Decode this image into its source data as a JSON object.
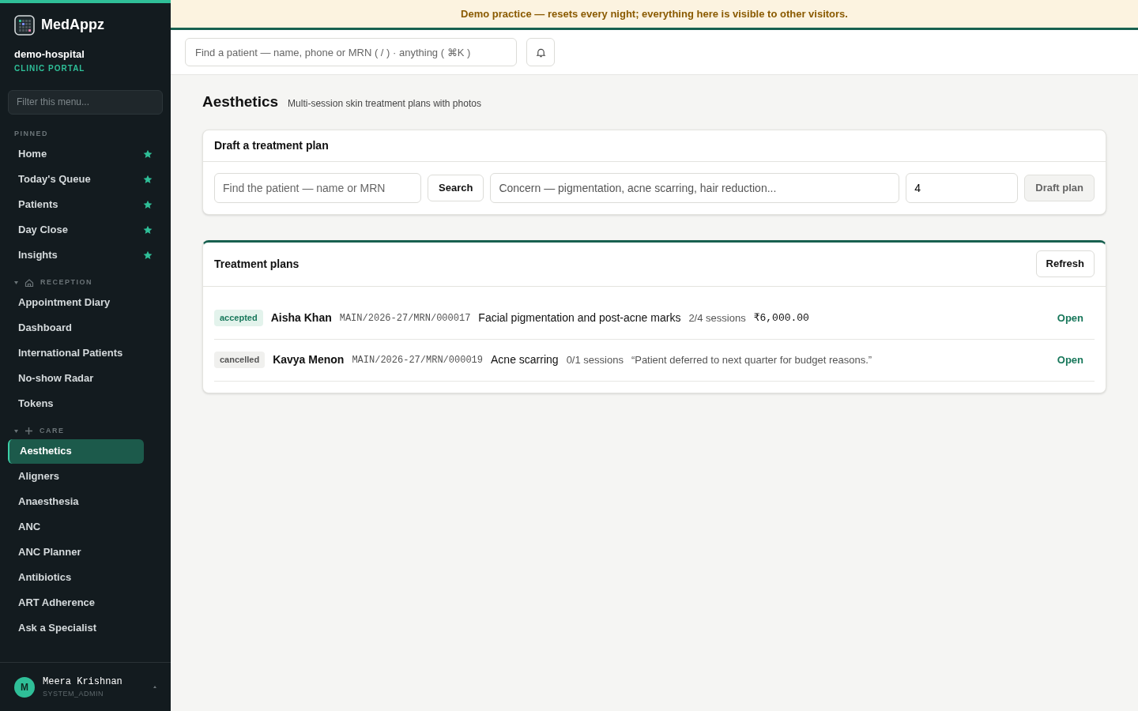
{
  "brand": {
    "name": "MedAppz",
    "org": "demo-hospital",
    "portal": "CLINIC PORTAL"
  },
  "sidebar": {
    "filter_placeholder": "Filter this menu...",
    "sections": [
      {
        "title": "PINNED",
        "kind": "pinned",
        "items": [
          {
            "label": "Home",
            "pinned": true,
            "selected": false
          },
          {
            "label": "Today's Queue",
            "pinned": true,
            "selected": false
          },
          {
            "label": "Patients",
            "pinned": true,
            "selected": false
          },
          {
            "label": "Day Close",
            "pinned": true,
            "selected": false
          },
          {
            "label": "Insights",
            "pinned": true,
            "selected": false
          }
        ]
      },
      {
        "title": "RECEPTION",
        "kind": "reception",
        "expanded": true,
        "items": [
          {
            "label": "Appointment Diary",
            "pinned": false,
            "selected": false
          },
          {
            "label": "Dashboard",
            "pinned": false,
            "selected": false
          },
          {
            "label": "International Patients",
            "pinned": false,
            "selected": false
          },
          {
            "label": "No-show Radar",
            "pinned": false,
            "selected": false
          },
          {
            "label": "Tokens",
            "pinned": false,
            "selected": false
          }
        ]
      },
      {
        "title": "CARE",
        "kind": "care",
        "expanded": true,
        "items": [
          {
            "label": "Aesthetics",
            "pinned": false,
            "selected": true
          },
          {
            "label": "Aligners",
            "pinned": false,
            "selected": false
          },
          {
            "label": "Anaesthesia",
            "pinned": false,
            "selected": false
          },
          {
            "label": "ANC",
            "pinned": false,
            "selected": false
          },
          {
            "label": "ANC Planner",
            "pinned": false,
            "selected": false
          },
          {
            "label": "Antibiotics",
            "pinned": false,
            "selected": false
          },
          {
            "label": "ART Adherence",
            "pinned": false,
            "selected": false
          },
          {
            "label": "Ask a Specialist",
            "pinned": false,
            "selected": false
          }
        ]
      }
    ],
    "user": {
      "initial": "M",
      "name": "Meera Krishnan",
      "role": "SYSTEM_ADMIN"
    }
  },
  "banner": "Demo practice — resets every night; everything here is visible to other visitors.",
  "topbar": {
    "search_placeholder": "Find a patient — name, phone or MRN ( / ) · anything ( ⌘K )"
  },
  "page": {
    "title": "Aesthetics",
    "subtitle": "Multi-session skin treatment plans with photos"
  },
  "draft": {
    "title": "Draft a treatment plan",
    "patient_placeholder": "Find the patient — name or MRN",
    "search_button": "Search",
    "concern_placeholder": "Concern — pigmentation, acne scarring, hair reduction...",
    "sessions_value": "4",
    "draft_button": "Draft plan",
    "draft_disabled": true
  },
  "plans": {
    "title": "Treatment plans",
    "refresh": "Refresh",
    "rows": [
      {
        "status": "accepted",
        "name": "Aisha Khan",
        "mrn": "MAIN/2026-27/MRN/000017",
        "concern": "Facial pigmentation and post-acne marks",
        "sessions": "2/4 sessions",
        "amount": "₹6,000.00",
        "action": "Open"
      },
      {
        "status": "cancelled",
        "name": "Kavya Menon",
        "mrn": "MAIN/2026-27/MRN/000019",
        "concern": "Acne scarring",
        "sessions": "0/1 sessions",
        "note": "“Patient deferred to next quarter for budget reasons.”",
        "action": "Open"
      }
    ]
  }
}
